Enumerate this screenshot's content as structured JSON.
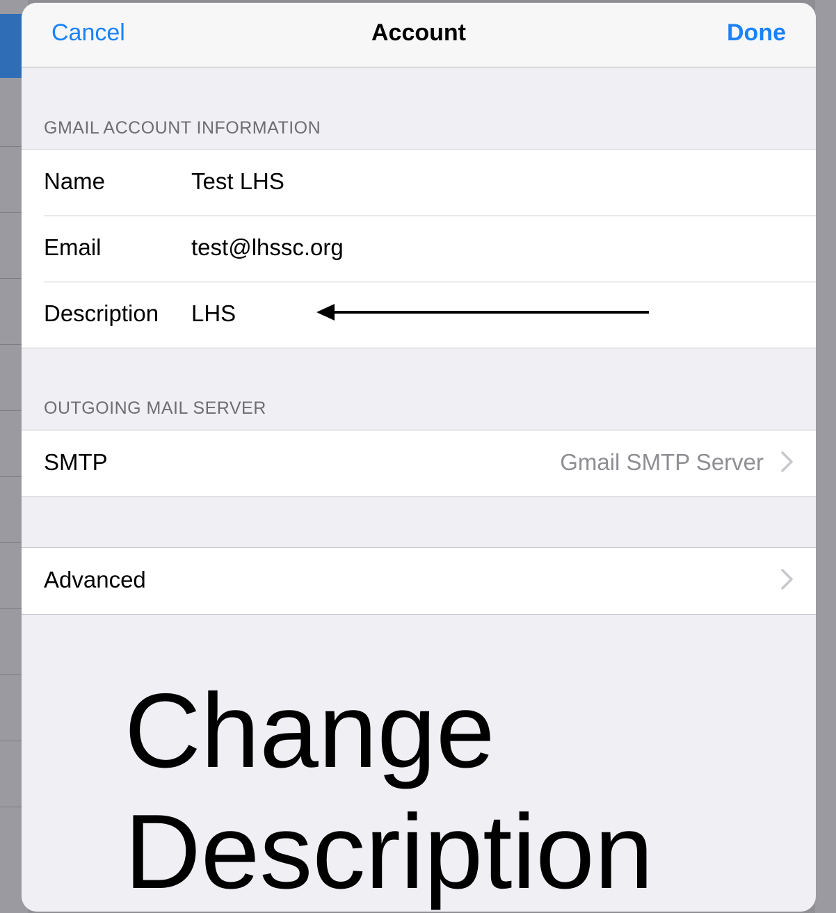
{
  "navbar": {
    "cancel_label": "Cancel",
    "title": "Account",
    "done_label": "Done"
  },
  "account_section": {
    "header": "GMAIL ACCOUNT INFORMATION",
    "rows": [
      {
        "label": "Name",
        "value": "Test LHS"
      },
      {
        "label": "Email",
        "value": "test@lhssc.org"
      },
      {
        "label": "Description",
        "value": "LHS"
      }
    ]
  },
  "outgoing_section": {
    "header": "OUTGOING MAIL SERVER",
    "smtp_label": "SMTP",
    "smtp_value": "Gmail SMTP Server"
  },
  "advanced": {
    "label": "Advanced"
  },
  "annotation": {
    "line1": "Change",
    "line2": "Description"
  },
  "icons": {
    "chevron": "chevron-right-icon",
    "arrow": "arrow-left-icon"
  },
  "colors": {
    "accent": "#1a82fb",
    "background": "#efeff4",
    "secondary_text": "#6d6d72"
  }
}
